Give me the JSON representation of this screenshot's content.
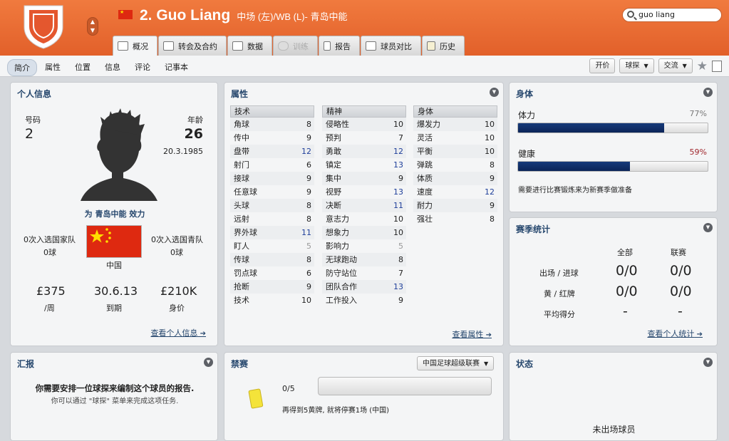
{
  "header": {
    "number_name": "2. Guo Liang",
    "position_club": "中场 (左)/WB (L)- 青岛中能",
    "search_value": "guo liang",
    "tabs": [
      {
        "label": "概况"
      },
      {
        "label": "转会及合约"
      },
      {
        "label": "数据"
      },
      {
        "label": "训练"
      },
      {
        "label": "报告"
      },
      {
        "label": "球员对比"
      },
      {
        "label": "历史"
      }
    ]
  },
  "subnav": {
    "items": [
      "简介",
      "属性",
      "位置",
      "信息",
      "评论",
      "记事本"
    ],
    "right": {
      "bid": "开价",
      "scout": "球探",
      "trade": "交流"
    }
  },
  "personal": {
    "title": "个人信息",
    "number_label": "号码",
    "number": "2",
    "age_label": "年龄",
    "age": "26",
    "dob": "20.3.1985",
    "plays_for": "为 青岛中能 效力",
    "national_caps": "0次入选国家队",
    "national_goals": "0球",
    "youth_caps": "0次入选国青队",
    "youth_goals": "0球",
    "nation": "中国",
    "wage": "£375",
    "wage_label": "/周",
    "expires": "30.6.13",
    "expires_label": "到期",
    "value": "£210K",
    "value_label": "身价",
    "link": "查看个人信息"
  },
  "attributes": {
    "title": "属性",
    "link": "查看属性",
    "technical": {
      "head": "技术",
      "rows": [
        {
          "n": "角球",
          "v": "8",
          "s": ""
        },
        {
          "n": "传中",
          "v": "9",
          "s": ""
        },
        {
          "n": "盘带",
          "v": "12",
          "s": "blue"
        },
        {
          "n": "射门",
          "v": "6",
          "s": ""
        },
        {
          "n": "接球",
          "v": "9",
          "s": ""
        },
        {
          "n": "任意球",
          "v": "9",
          "s": ""
        },
        {
          "n": "头球",
          "v": "8",
          "s": ""
        },
        {
          "n": "远射",
          "v": "8",
          "s": ""
        },
        {
          "n": "界外球",
          "v": "11",
          "s": "blue"
        },
        {
          "n": "盯人",
          "v": "5",
          "s": "grey"
        },
        {
          "n": "传球",
          "v": "8",
          "s": ""
        },
        {
          "n": "罚点球",
          "v": "6",
          "s": ""
        },
        {
          "n": "抢断",
          "v": "9",
          "s": ""
        },
        {
          "n": "技术",
          "v": "10",
          "s": ""
        }
      ]
    },
    "mental": {
      "head": "精神",
      "rows": [
        {
          "n": "侵略性",
          "v": "10",
          "s": ""
        },
        {
          "n": "预判",
          "v": "7",
          "s": ""
        },
        {
          "n": "勇敢",
          "v": "12",
          "s": "blue"
        },
        {
          "n": "镇定",
          "v": "13",
          "s": "blue"
        },
        {
          "n": "集中",
          "v": "9",
          "s": ""
        },
        {
          "n": "视野",
          "v": "13",
          "s": "blue"
        },
        {
          "n": "决断",
          "v": "11",
          "s": "blue"
        },
        {
          "n": "意志力",
          "v": "10",
          "s": ""
        },
        {
          "n": "想象力",
          "v": "10",
          "s": ""
        },
        {
          "n": "影响力",
          "v": "5",
          "s": "grey"
        },
        {
          "n": "无球跑动",
          "v": "8",
          "s": ""
        },
        {
          "n": "防守站位",
          "v": "7",
          "s": ""
        },
        {
          "n": "团队合作",
          "v": "13",
          "s": "blue"
        },
        {
          "n": "工作投入",
          "v": "9",
          "s": ""
        }
      ]
    },
    "physical": {
      "head": "身体",
      "rows": [
        {
          "n": "爆发力",
          "v": "10",
          "s": ""
        },
        {
          "n": "灵活",
          "v": "10",
          "s": ""
        },
        {
          "n": "平衡",
          "v": "10",
          "s": ""
        },
        {
          "n": "弹跳",
          "v": "8",
          "s": ""
        },
        {
          "n": "体质",
          "v": "9",
          "s": ""
        },
        {
          "n": "速度",
          "v": "12",
          "s": "blue"
        },
        {
          "n": "耐力",
          "v": "9",
          "s": ""
        },
        {
          "n": "强壮",
          "v": "8",
          "s": ""
        }
      ]
    }
  },
  "physical_state": {
    "title": "身体",
    "fitness_label": "体力",
    "fitness_text": "77%",
    "fitness_value": 0.77,
    "health_label": "健康",
    "health_text": "59%",
    "health_value": 0.59,
    "note": "需要进行比赛锻炼来为新赛季做准备"
  },
  "season_stats": {
    "title": "赛季统计",
    "col_all": "全部",
    "col_league": "联赛",
    "row1_label": "出场 / 进球",
    "row1_all": "0/0",
    "row1_league": "0/0",
    "row2_label": "黄 / 红牌",
    "row2_all": "0/0",
    "row2_league": "0/0",
    "row3_label": "平均得分",
    "row3_all": "-",
    "row3_league": "-",
    "link": "查看个人统计"
  },
  "report": {
    "title": "汇报",
    "main": "你需要安排一位球探来编制这个球员的报告.",
    "sub": "你可以通过 \"球探\" 菜单来完成这项任务."
  },
  "bans": {
    "title": "禁赛",
    "competition": "中国足球超级联赛",
    "count": "0/5",
    "note": "再得到5黄牌, 就将停赛1场 (中国)",
    "progress": 0
  },
  "status": {
    "title": "状态",
    "text": "未出场球员"
  },
  "colors": {
    "accent": "#e8672f",
    "bar": "#0f2f6b",
    "link": "#27486e"
  }
}
